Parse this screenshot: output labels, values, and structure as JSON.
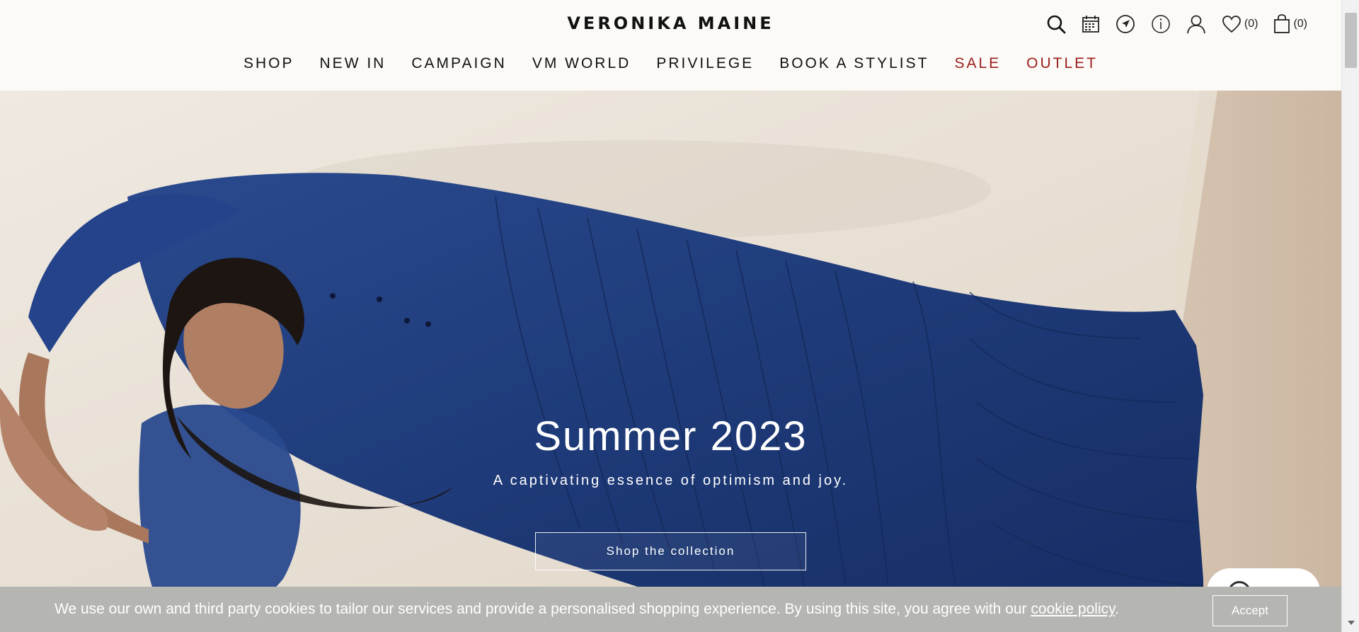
{
  "brand": {
    "logo": "VERONIKA MAINE"
  },
  "header_icons": {
    "search": "search-icon",
    "calendar": "calendar-icon",
    "location": "location-arrow-icon",
    "info": "info-icon",
    "account": "user-icon",
    "wishlist": "heart-icon",
    "wishlist_count": "(0)",
    "bag": "shopping-bag-icon",
    "bag_count": "(0)"
  },
  "nav": {
    "items": [
      {
        "label": "SHOP",
        "accent": false
      },
      {
        "label": "NEW IN",
        "accent": false
      },
      {
        "label": "CAMPAIGN",
        "accent": false
      },
      {
        "label": "VM WORLD",
        "accent": false
      },
      {
        "label": "PRIVILEGE",
        "accent": false
      },
      {
        "label": "BOOK A STYLIST",
        "accent": false
      },
      {
        "label": "SALE",
        "accent": true
      },
      {
        "label": "OUTLET",
        "accent": true
      }
    ],
    "accent_color": "#9b1d1d"
  },
  "hero": {
    "title": "Summer 2023",
    "subtitle": "A captivating essence of optimism and joy.",
    "cta_label": "Shop the collection"
  },
  "cookie": {
    "text": "We use our own and third party cookies to tailor our services and provide a personalised shopping experience. By using this site, you agree with our ",
    "link_label": "cookie policy",
    "suffix": ".",
    "accept_label": "Accept"
  },
  "colors": {
    "background": "#fbfaf6",
    "dress": "#1e3a78",
    "cookie_bar": "#b5b5b2"
  }
}
